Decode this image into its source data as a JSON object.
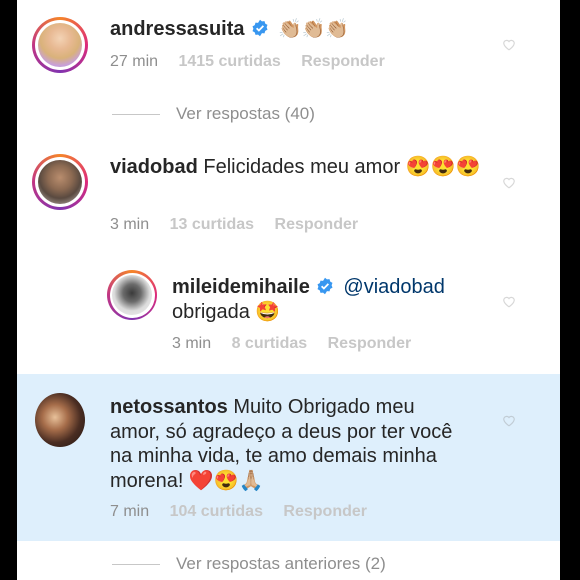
{
  "comments": [
    {
      "username": "andressasuita",
      "verified": true,
      "text": "👏🏼👏🏼👏🏼",
      "time": "27 min",
      "likes": "1415 curtidas",
      "reply": "Responder"
    },
    {
      "username": "viadobad",
      "verified": false,
      "text": "Felicidades meu amor 😍😍😍",
      "time": "3 min",
      "likes": "13 curtidas",
      "reply": "Responder"
    },
    {
      "username": "mileidemihaile",
      "verified": true,
      "mention": "@viadobad",
      "text": "obrigada 🤩",
      "time": "3 min",
      "likes": "8 curtidas",
      "reply": "Responder"
    },
    {
      "username": "netossantos",
      "verified": false,
      "text": "Muito Obrigado meu amor, só agradeço a deus por ter você na minha vida, te amo demais minha morena! ❤️😍🙏🏼",
      "time": "7 min",
      "likes": "104 curtidas",
      "reply": "Responder"
    }
  ],
  "view_replies": "Ver respostas (40)",
  "view_previous_replies": "Ver respostas anteriores (2)",
  "colors": {
    "verified": "#3897f0",
    "highlight": "#deeffc",
    "muted": "#8e8e8e"
  }
}
